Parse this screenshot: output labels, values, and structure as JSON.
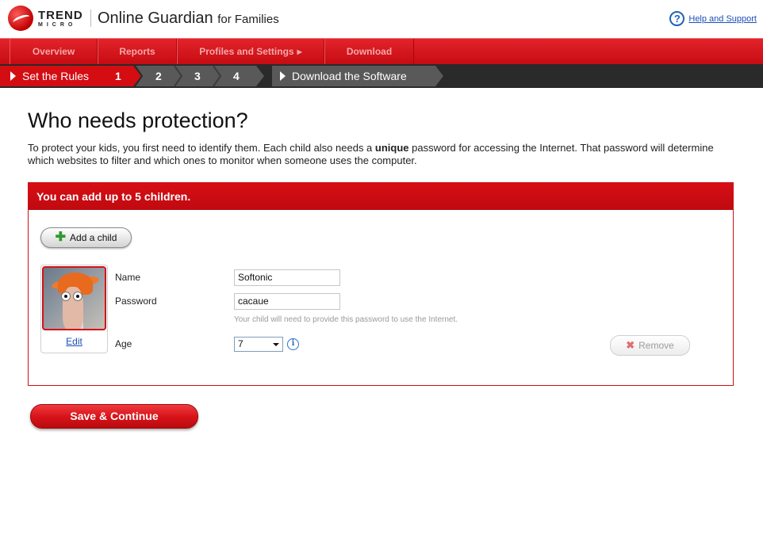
{
  "header": {
    "logo_top": "TREND",
    "logo_bottom": "MICRO",
    "product_name": "Online Guardian",
    "product_suffix": "for Families",
    "help_label": "Help and Support"
  },
  "nav": {
    "items": [
      {
        "label": "Overview"
      },
      {
        "label": "Reports"
      },
      {
        "label": "Profiles and Settings"
      },
      {
        "label": "Download"
      }
    ]
  },
  "steps": {
    "set_rules_label": "Set the Rules",
    "numbers": [
      "1",
      "2",
      "3",
      "4"
    ],
    "active_step": "1",
    "download_label": "Download the Software"
  },
  "main": {
    "title": "Who needs protection?",
    "intro_before": "To protect your kids, you first need to identify them. Each child also needs a ",
    "intro_bold": "unique",
    "intro_after": " password for accessing the Internet. That password will determine which websites to filter and which ones to monitor when someone uses the computer."
  },
  "panel": {
    "header": "You can add up to 5 children.",
    "add_child_label": "Add a child",
    "edit_label": "Edit",
    "name_label": "Name",
    "name_value": "Softonic",
    "password_label": "Password",
    "password_value": "cacaue",
    "password_hint": "Your child will need to provide this password to use the Internet.",
    "age_label": "Age",
    "age_value": "7",
    "remove_label": "Remove"
  },
  "footer": {
    "save_label": "Save & Continue"
  },
  "colors": {
    "brand_red": "#d40d13",
    "link_blue": "#1d4fb5",
    "steps_bg": "#2a2a2a"
  }
}
